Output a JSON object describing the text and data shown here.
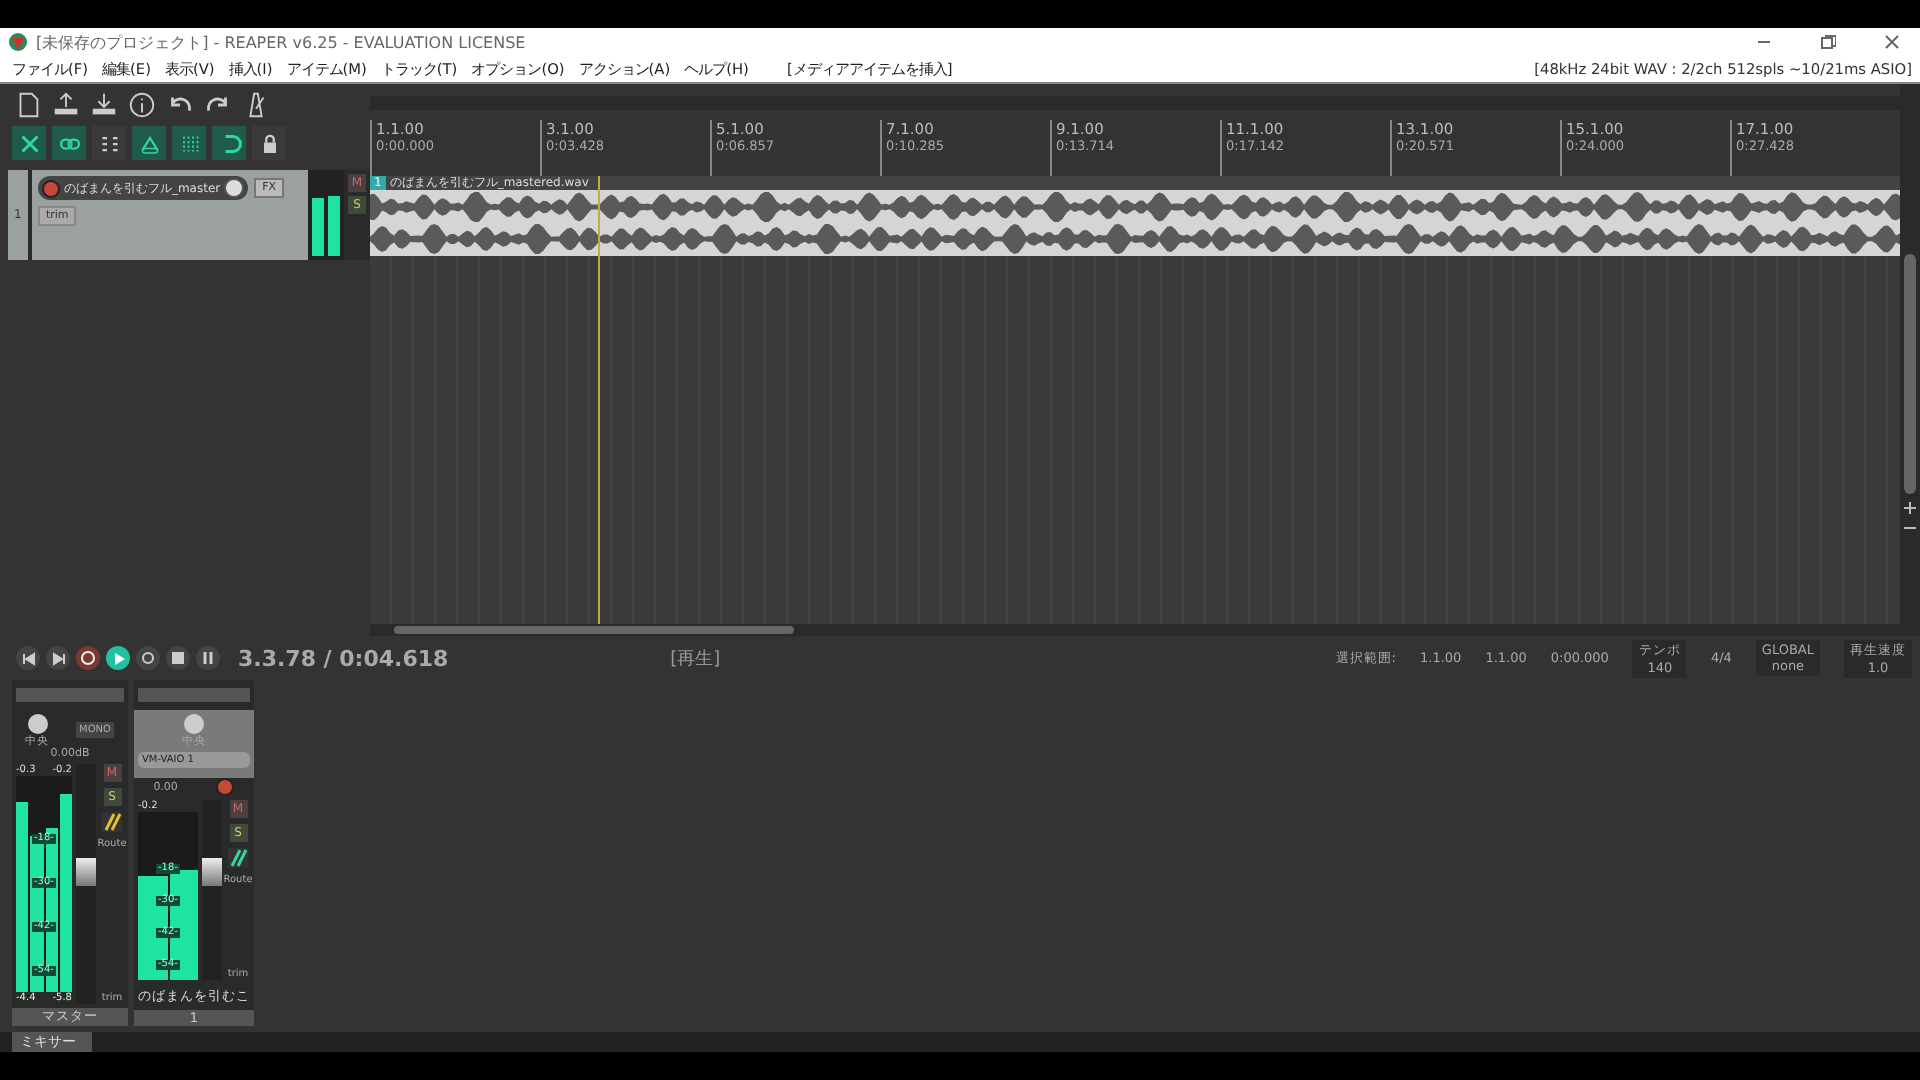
{
  "window": {
    "title": "[未保存のプロジェクト] - REAPER v6.25 - EVALUATION LICENSE"
  },
  "menu": {
    "items": [
      "ファイル(F)",
      "編集(E)",
      "表示(V)",
      "挿入(I)",
      "アイテム(M)",
      "トラック(T)",
      "オプション(O)",
      "アクション(A)",
      "ヘルプ(H)"
    ],
    "hint": "[メディアアイテムを挿入]",
    "status": "[48kHz 24bit WAV : 2/2ch 512spls ~10/21ms ASIO]"
  },
  "toolbar": {
    "toggles": [
      {
        "kind": "ripple",
        "on": true
      },
      {
        "kind": "link",
        "on": true
      },
      {
        "kind": "grid-view",
        "on": false
      },
      {
        "kind": "envelope",
        "on": true
      },
      {
        "kind": "grid",
        "on": true
      },
      {
        "kind": "loop",
        "on": true
      },
      {
        "kind": "lock",
        "on": false
      }
    ]
  },
  "track": {
    "number": "1",
    "name": "のばまんを引むフル_master",
    "armed": true,
    "fx": "FX",
    "mute": "M",
    "solo": "S",
    "trim": "trim",
    "meter": [
      {
        "level": 0.7
      },
      {
        "level": 0.74
      }
    ]
  },
  "ruler": [
    {
      "bar": "1.1.00",
      "time": "0:00.000"
    },
    {
      "bar": "3.1.00",
      "time": "0:03.428"
    },
    {
      "bar": "5.1.00",
      "time": "0:06.857"
    },
    {
      "bar": "7.1.00",
      "time": "0:10.285"
    },
    {
      "bar": "9.1.00",
      "time": "0:13.714"
    },
    {
      "bar": "11.1.00",
      "time": "0:17.142"
    },
    {
      "bar": "13.1.00",
      "time": "0:20.571"
    },
    {
      "bar": "15.1.00",
      "time": "0:24.000"
    },
    {
      "bar": "17.1.00",
      "time": "0:27.428"
    }
  ],
  "item": {
    "number": "1",
    "name": "のばまんを引むフル_mastered.wav"
  },
  "playhead": {
    "level": 0.149
  },
  "transport": {
    "recording": false,
    "playing": true,
    "repeat": false,
    "position": "3.3.78 / 0:04.618",
    "state": "[再生]",
    "selection_label": "選択範囲:",
    "selection": [
      "1.1.00",
      "1.1.00",
      "0:00.000"
    ],
    "tempo_label": "テンポ",
    "tempo": "140",
    "signature": "4/4",
    "global": "GLOBAL",
    "global_value": "none",
    "rate_label": "再生速度",
    "rate": "1.0"
  },
  "mixer": {
    "master": {
      "pan": "中央",
      "mono": "MONO",
      "volume": "0.00dB",
      "peaks": [
        "-0.3",
        "-0.2"
      ],
      "scale": [
        "-18-",
        "-30-",
        "-42-",
        "-54-"
      ],
      "holds": [
        "-4.4",
        "-5.8"
      ],
      "mute": "M",
      "solo": "S",
      "route": "Route",
      "trim": "trim",
      "name": "マスター",
      "fader": {
        "level": 0.55
      },
      "meter": [
        {
          "level": 0.88
        },
        {
          "level": 0.72
        },
        {
          "level": 0.76
        },
        {
          "level": 0.92
        }
      ]
    },
    "tracks": [
      {
        "pan": "中央",
        "input": "VM-VAIO 1",
        "armed": true,
        "volume": "0.00",
        "peak": "-0.2",
        "scale": [
          "-18-",
          "-30-",
          "-42-",
          "-54-"
        ],
        "mute": "M",
        "solo": "S",
        "route": "Route",
        "trim": "trim",
        "name": "のばまんを引むこ",
        "number": "1",
        "fader": {
          "level": 0.6
        },
        "meter": [
          {
            "level": 0.62
          },
          {
            "level": 0.66
          }
        ]
      }
    ],
    "tab": "ミキサー"
  }
}
